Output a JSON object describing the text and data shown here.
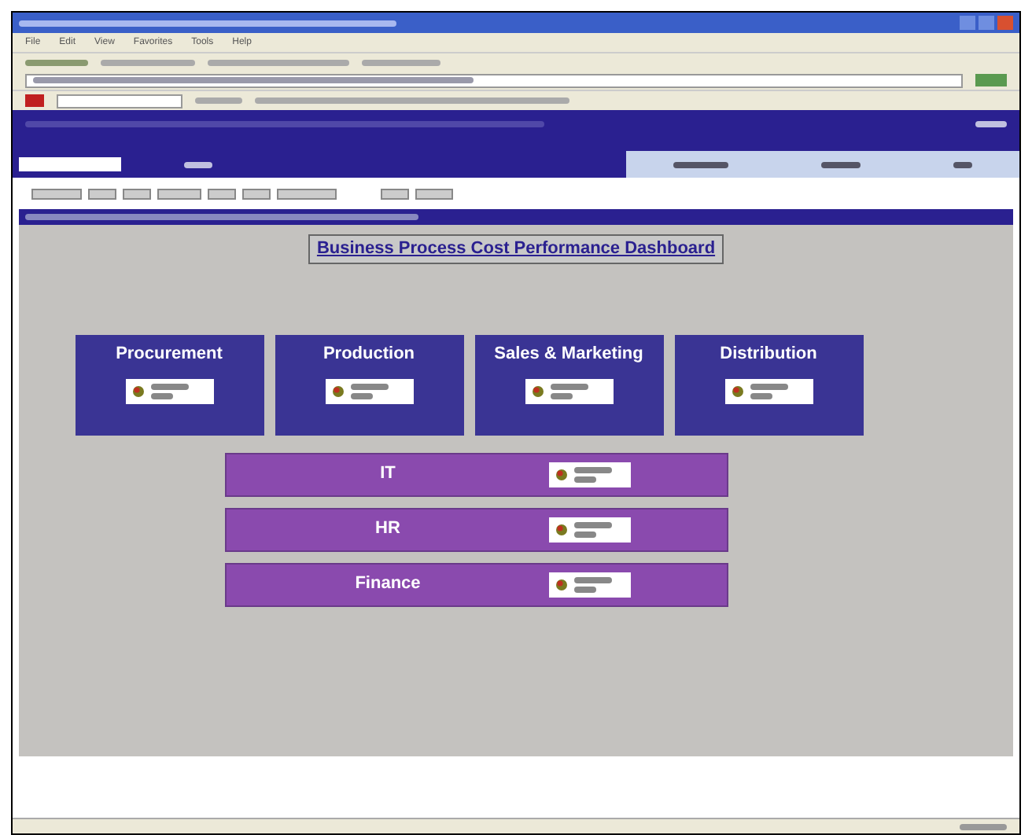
{
  "browser": {
    "menu": [
      "File",
      "Edit",
      "View",
      "Favorites",
      "Tools",
      "Help"
    ]
  },
  "dashboard": {
    "title": "Business Process Cost Performance Dashboard",
    "cards": [
      {
        "name": "Procurement"
      },
      {
        "name": "Production"
      },
      {
        "name": "Sales & Marketing"
      },
      {
        "name": "Distribution"
      }
    ],
    "bars": [
      {
        "name": "IT"
      },
      {
        "name": "HR"
      },
      {
        "name": "Finance"
      }
    ]
  }
}
